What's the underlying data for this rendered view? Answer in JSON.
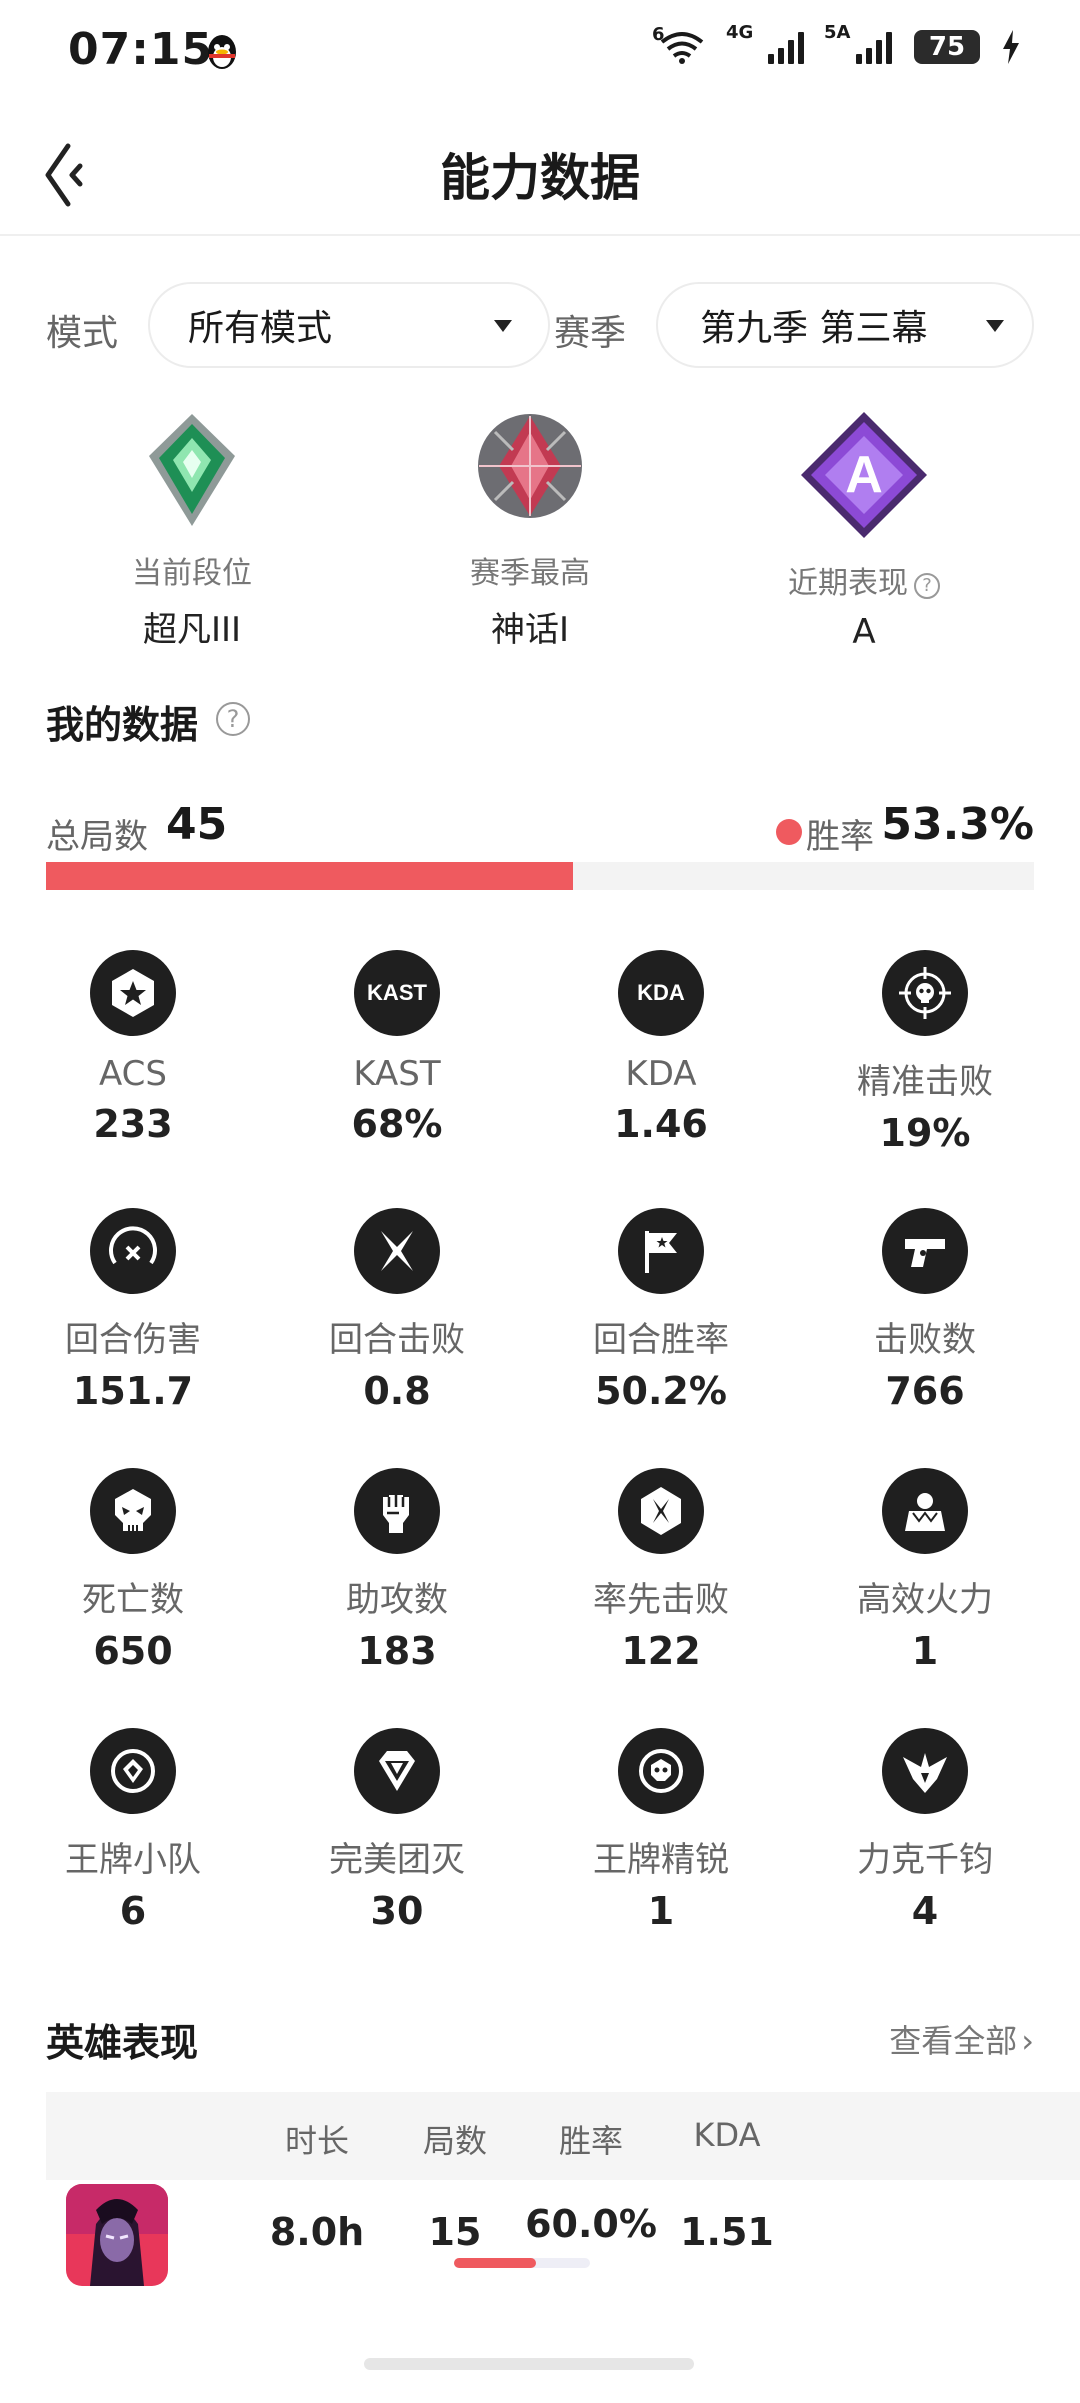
{
  "status_bar": {
    "time": "07:15",
    "wifi_label": "6",
    "net1_label": "4G",
    "net2_label": "5A",
    "battery": "75"
  },
  "header": {
    "title": "能力数据"
  },
  "filters": {
    "mode_label": "模式",
    "mode_value": "所有模式",
    "season_label": "赛季",
    "season_value": "第九季 第三幕"
  },
  "ranks": [
    {
      "caption": "当前段位",
      "value": "超凡III"
    },
    {
      "caption": "赛季最高",
      "value": "神话I"
    },
    {
      "caption": "近期表现",
      "value": "A",
      "badge_letter": "A"
    }
  ],
  "my_data": {
    "title": "我的数据",
    "total_label": "总局数",
    "total_value": "45",
    "winrate_label": "胜率",
    "winrate_value": "53.3%",
    "winrate_fraction": 0.533
  },
  "stats": [
    {
      "icon": "star-hexagon-icon",
      "label": "ACS",
      "value": "233"
    },
    {
      "icon": "kast-icon",
      "icon_text": "KAST",
      "label": "KAST",
      "value": "68%"
    },
    {
      "icon": "kda-icon",
      "icon_text": "KDA",
      "label": "KDA",
      "value": "1.46"
    },
    {
      "icon": "crosshair-skull-icon",
      "label": "精准击败",
      "value": "19%"
    },
    {
      "icon": "round-damage-icon",
      "label": "回合伤害",
      "value": "151.7"
    },
    {
      "icon": "crossed-blades-icon",
      "label": "回合击败",
      "value": "0.8"
    },
    {
      "icon": "flag-icon",
      "label": "回合胜率",
      "value": "50.2%"
    },
    {
      "icon": "pistol-icon",
      "label": "击败数",
      "value": "766"
    },
    {
      "icon": "skull-icon",
      "label": "死亡数",
      "value": "650"
    },
    {
      "icon": "fist-icon",
      "label": "助攻数",
      "value": "183"
    },
    {
      "icon": "first-blood-icon",
      "label": "率先击败",
      "value": "122"
    },
    {
      "icon": "multikill-icon",
      "label": "高效火力",
      "value": "1"
    },
    {
      "icon": "ace-squad-icon",
      "label": "王牌小队",
      "value": "6"
    },
    {
      "icon": "flawless-icon",
      "label": "完美团灭",
      "value": "30"
    },
    {
      "icon": "ace-elite-icon",
      "label": "王牌精锐",
      "value": "1"
    },
    {
      "icon": "clutch-icon",
      "label": "力克千钧",
      "value": "4"
    }
  ],
  "heroes": {
    "title": "英雄表现",
    "view_all": "查看全部",
    "columns": [
      "时长",
      "局数",
      "胜率",
      "KDA"
    ],
    "rows": [
      {
        "time": "8.0h",
        "games": "15",
        "winrate": "60.0%",
        "winrate_fraction": 0.6,
        "kda": "1.51"
      }
    ]
  },
  "colors": {
    "accent": "#ef5a5f",
    "icon_bg": "#1f1f1f"
  }
}
